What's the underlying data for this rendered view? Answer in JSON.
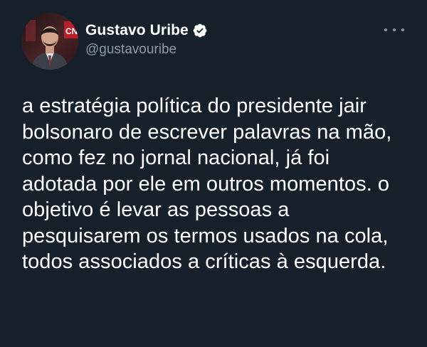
{
  "author": {
    "display_name": "Gustavo Uribe",
    "handle": "@gustavouribe",
    "verified": true,
    "avatar_badge": "CNN"
  },
  "icons": {
    "verified": "verified-badge-icon",
    "more": "more-options-icon"
  },
  "tweet": {
    "text": "a estratégia política do presidente jair bolsonaro de escrever palavras na mão, como fez no jornal nacional, já foi adotada por ele em outros momentos. o objetivo é levar as pessoas a pesquisarem os termos usados na cola, todos associados a críticas à esquerda."
  },
  "colors": {
    "background": "#15202b",
    "text_primary": "#ffffff",
    "text_secondary": "#8b98a5",
    "verified_badge": "#ffffff"
  }
}
